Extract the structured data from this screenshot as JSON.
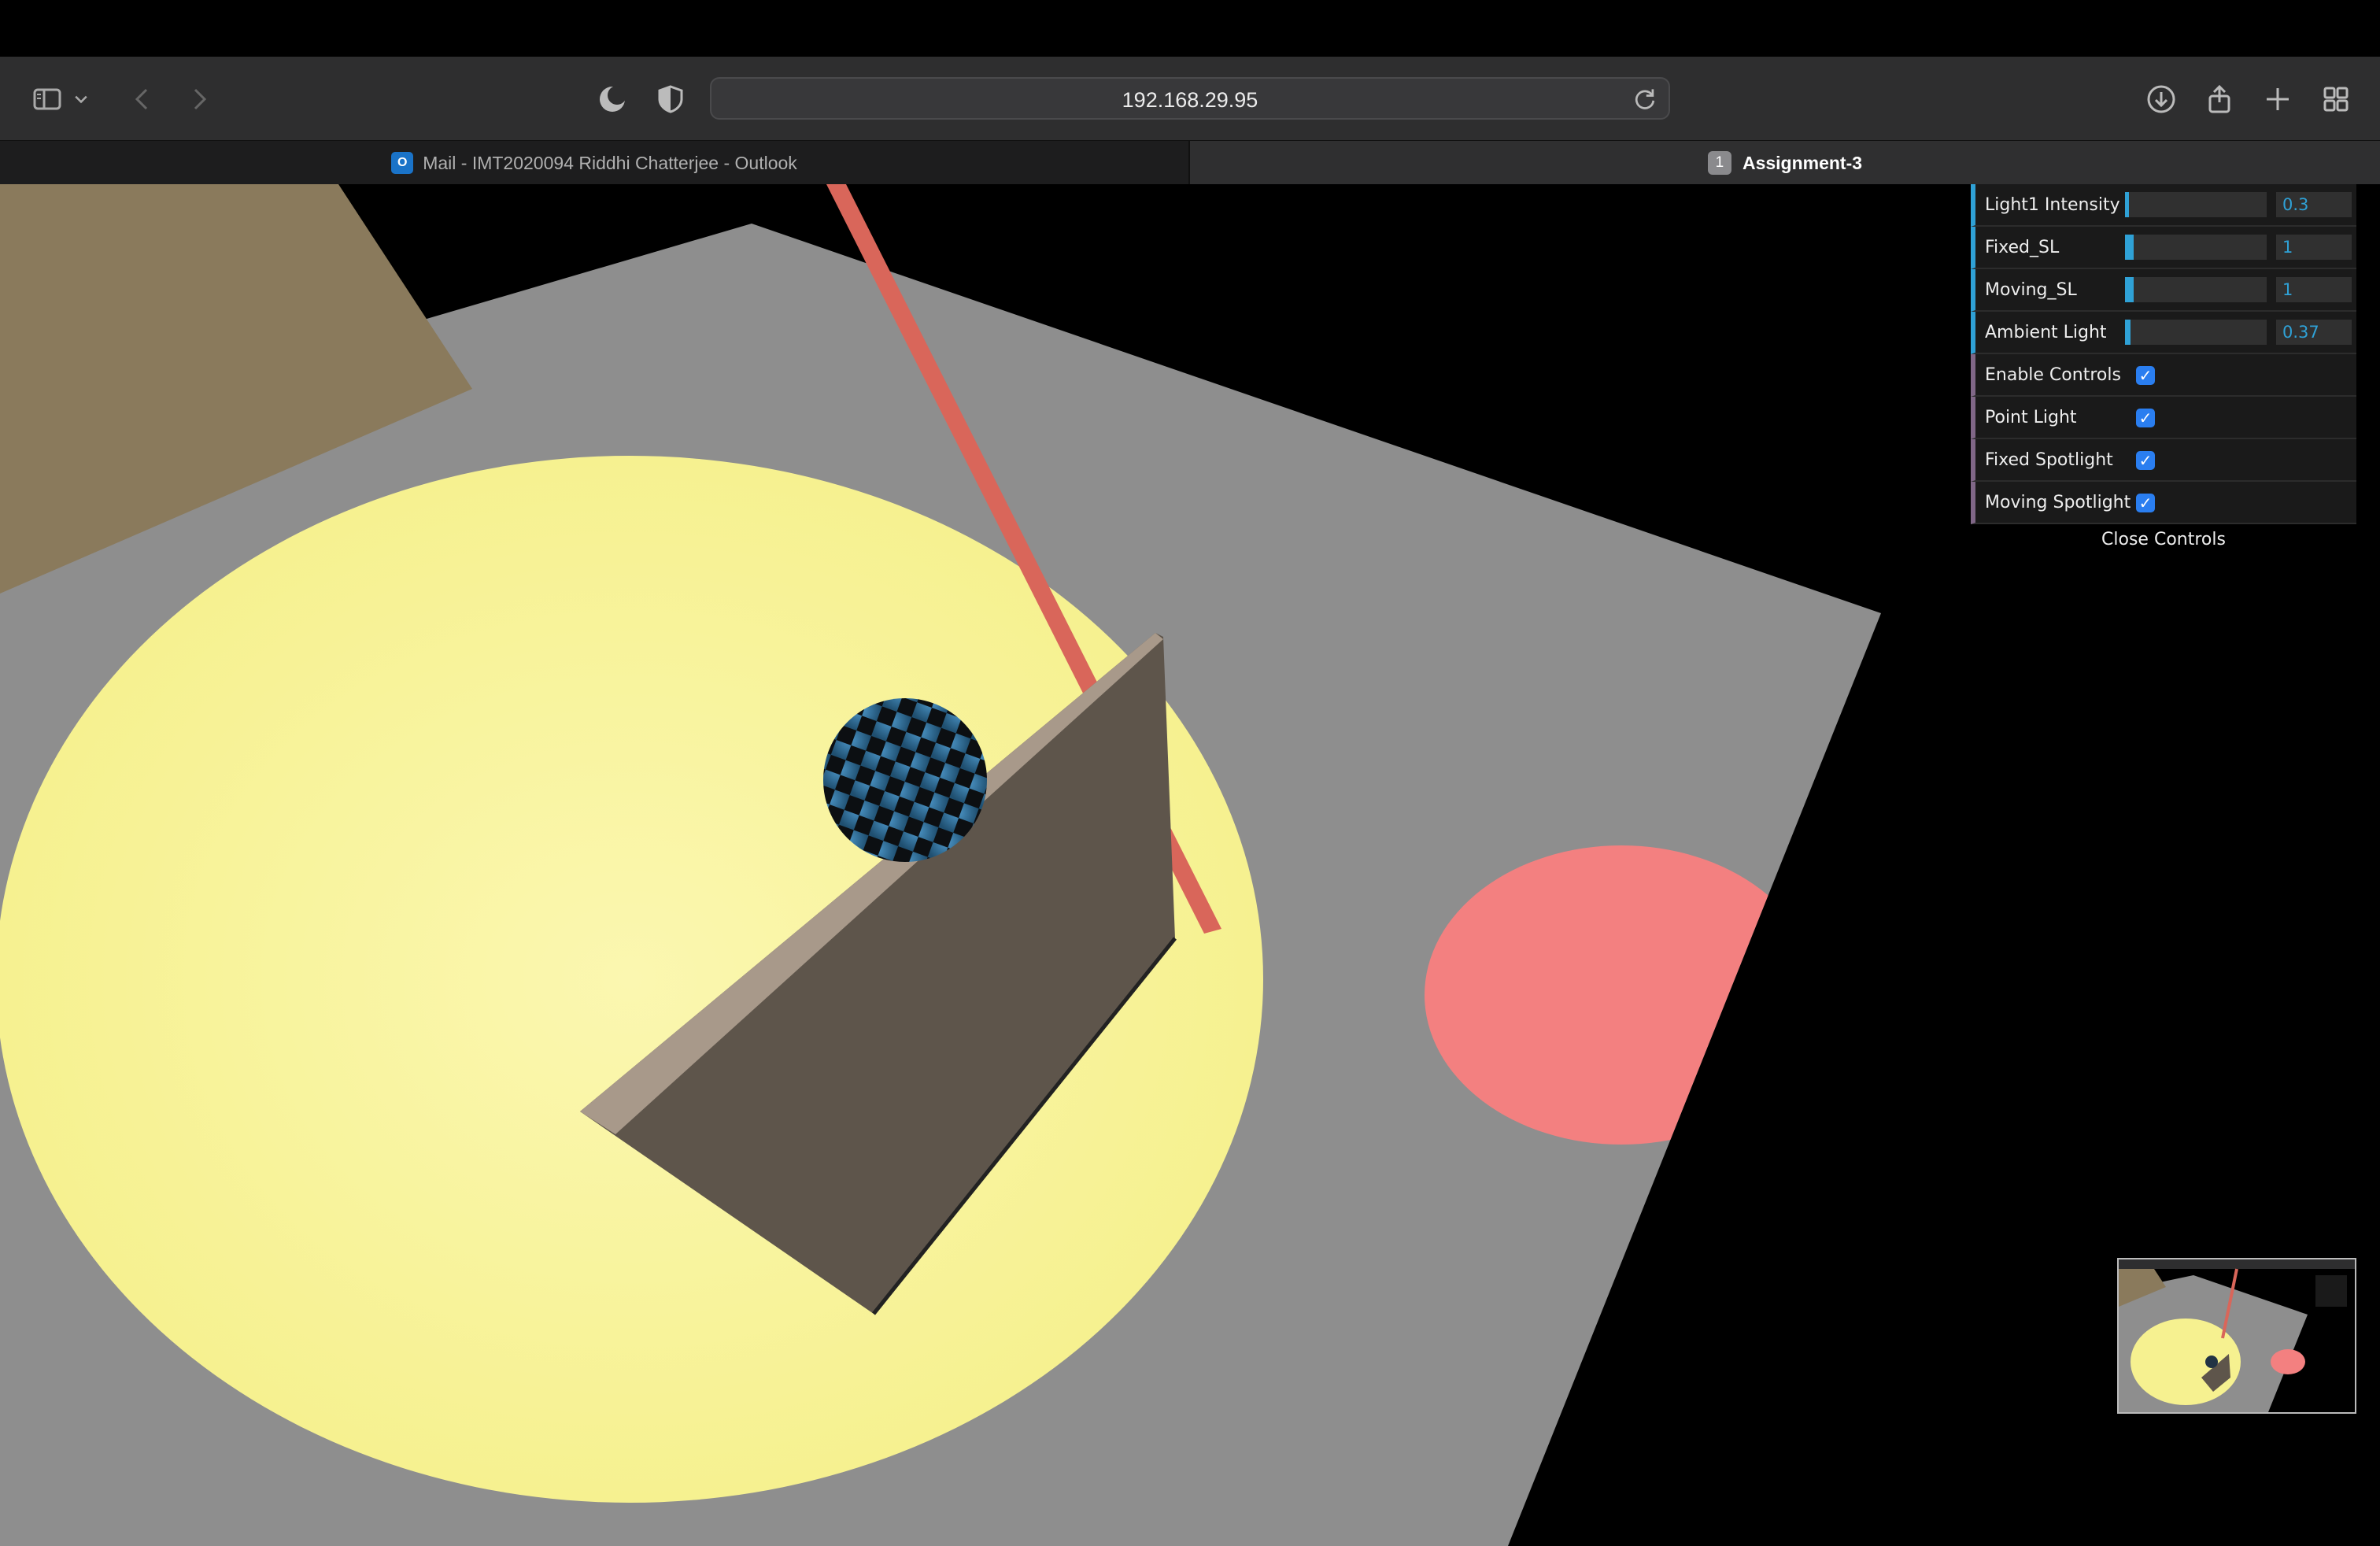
{
  "browser": {
    "address": "192.168.29.95",
    "tabs": [
      {
        "label": "Mail - IMT2020094 Riddhi Chatterjee - Outlook",
        "badge": "O"
      },
      {
        "label": "Assignment-3",
        "badge": "1"
      }
    ]
  },
  "controls": {
    "sliders": [
      {
        "label": "Light1 Intensity",
        "value": "0.3",
        "fraction": 0.03
      },
      {
        "label": "Fixed_SL",
        "value": "1",
        "fraction": 0.06
      },
      {
        "label": "Moving_SL",
        "value": "1",
        "fraction": 0.06
      },
      {
        "label": "Ambient Light",
        "value": "0.37",
        "fraction": 0.04
      }
    ],
    "toggles": [
      {
        "label": "Enable Controls",
        "checked": true
      },
      {
        "label": "Point Light",
        "checked": true
      },
      {
        "label": "Fixed Spotlight",
        "checked": true
      },
      {
        "label": "Moving Spotlight",
        "checked": true
      }
    ],
    "close_label": "Close Controls"
  },
  "colors": {
    "slider_accent": "#2fa1d6",
    "checkbox": "#2a7ef0",
    "spotlight_yellow": "#fbf79a",
    "spotlight_red": "#f38080",
    "pole": "#d9665a",
    "sphere": "#3d83b3"
  }
}
